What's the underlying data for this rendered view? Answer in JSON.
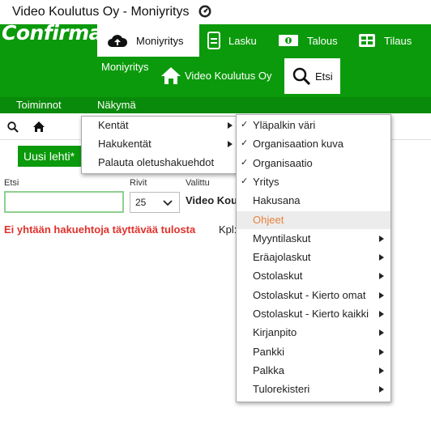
{
  "window": {
    "title": "Video Koulutus Oy - Moniyritys"
  },
  "brand": {
    "logo": "Confirma",
    "color": "#0b9a0b"
  },
  "tabs": [
    {
      "label": "Moniyritys",
      "icon": "cloud-upload-icon"
    },
    {
      "label": "Lasku",
      "icon": "document-icon"
    },
    {
      "label": "Talous",
      "icon": "money-icon"
    },
    {
      "label": "Tilaus",
      "icon": "grid-icon"
    }
  ],
  "subtabs": [
    {
      "label": "Moniyritys"
    },
    {
      "label": "Video Koulutus Oy",
      "icon": "home-icon"
    },
    {
      "label": "Etsi",
      "icon": "search-icon"
    }
  ],
  "menubar": {
    "toiminnot": "Toiminnot",
    "nakyma": "Näkymä"
  },
  "page": {
    "new_tab": "Uusi lehti*",
    "search_label": "Etsi",
    "rows_label": "Rivit",
    "rows_value": "25",
    "selected_label": "Valittu",
    "selected_value": "Video Koul",
    "error": "Ei yhtään hakuehtoja täyttävää tulosta",
    "count_label": "Kpl:"
  },
  "view_menu": [
    {
      "label": "Kentät",
      "submenu": true
    },
    {
      "label": "Hakukentät",
      "submenu": true
    },
    {
      "label": "Palauta oletushakuehdot",
      "submenu": false
    }
  ],
  "fields_menu": [
    {
      "label": "Yläpalkin väri",
      "checked": true,
      "submenu": false
    },
    {
      "label": "Organisaation kuva",
      "checked": true,
      "submenu": false
    },
    {
      "label": "Organisaatio",
      "checked": true,
      "submenu": false
    },
    {
      "label": "Yritys",
      "checked": true,
      "submenu": false
    },
    {
      "label": "Hakusana",
      "checked": false,
      "submenu": false
    },
    {
      "label": "Ohjeet",
      "checked": false,
      "submenu": false,
      "highlighted": true
    },
    {
      "label": "Myyntilaskut",
      "checked": false,
      "submenu": true
    },
    {
      "label": "Eräajolaskut",
      "checked": false,
      "submenu": true
    },
    {
      "label": "Ostolaskut",
      "checked": false,
      "submenu": true
    },
    {
      "label": "Ostolaskut - Kierto omat",
      "checked": false,
      "submenu": true
    },
    {
      "label": "Ostolaskut - Kierto kaikki",
      "checked": false,
      "submenu": true
    },
    {
      "label": "Kirjanpito",
      "checked": false,
      "submenu": true
    },
    {
      "label": "Pankki",
      "checked": false,
      "submenu": true
    },
    {
      "label": "Palkka",
      "checked": false,
      "submenu": true
    },
    {
      "label": "Tulorekisteri",
      "checked": false,
      "submenu": true
    }
  ],
  "glyphs": {
    "check": "✓"
  }
}
